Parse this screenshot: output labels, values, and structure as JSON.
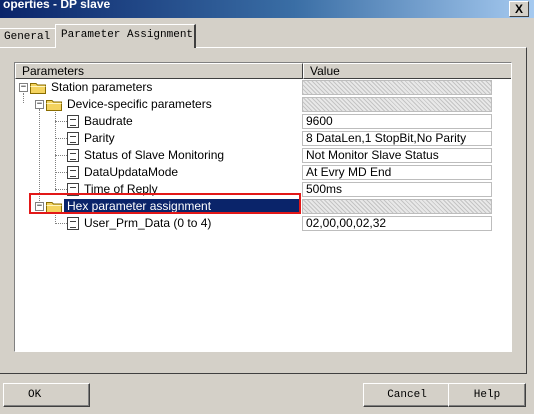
{
  "window": {
    "title": "operties - DP slave"
  },
  "tabs": [
    {
      "label": "General",
      "active": false
    },
    {
      "label": "Parameter Assignment",
      "active": true
    }
  ],
  "table": {
    "headers": {
      "parameters": "Parameters",
      "value": "Value"
    },
    "rows": [
      {
        "label": "Station parameters",
        "value": "",
        "kind": "folder",
        "depth": 0,
        "expanded": true
      },
      {
        "label": "Device-specific parameters",
        "value": "",
        "kind": "folder",
        "depth": 1,
        "expanded": true
      },
      {
        "label": "Baudrate",
        "value": "9600",
        "kind": "param",
        "depth": 2
      },
      {
        "label": "Parity",
        "value": "8 DataLen,1 StopBit,No Parity",
        "kind": "param",
        "depth": 2
      },
      {
        "label": "Status of Slave Monitoring",
        "value": "Not Monitor Slave Status",
        "kind": "param",
        "depth": 2
      },
      {
        "label": "DataUpdataMode",
        "value": "At Evry MD End",
        "kind": "param",
        "depth": 2
      },
      {
        "label": "Time of Reply",
        "value": "500ms",
        "kind": "param",
        "depth": 2
      },
      {
        "label": "Hex parameter assignment",
        "value": "",
        "kind": "folder",
        "depth": 1,
        "expanded": true,
        "selected": true
      },
      {
        "label": "User_Prm_Data (0 to 4)",
        "value": "02,00,00,02,32",
        "kind": "param",
        "depth": 2
      }
    ]
  },
  "buttons": {
    "ok": "OK",
    "cancel": "Cancel",
    "help": "Help"
  },
  "colors": {
    "dialog_bg": "#d4d0c8",
    "selection": "#0a246a",
    "annotation_box": "#e21818",
    "folder_yellow": "#f4d35e"
  },
  "icons": {
    "close": "close-icon",
    "folder": "folder-icon",
    "parameter": "document-icon",
    "expand": "minus-box-icon"
  }
}
